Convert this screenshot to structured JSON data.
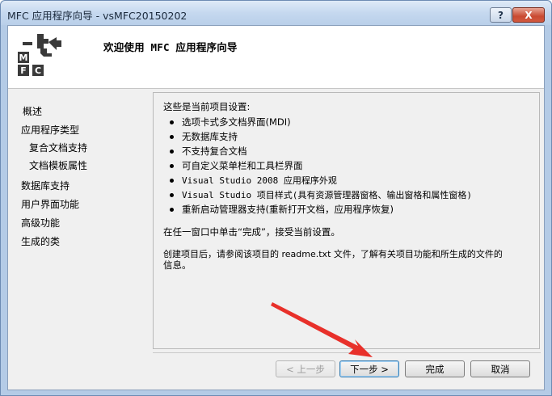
{
  "window": {
    "title": "MFC 应用程序向导 - vsMFC20150202",
    "help_label": "?",
    "close_label": "X"
  },
  "header": {
    "title": "欢迎使用 MFC 应用程序向导",
    "logo_letters": [
      "M",
      "F",
      "C"
    ]
  },
  "sidebar": {
    "items": [
      {
        "label": "概述"
      },
      {
        "label": "应用程序类型"
      },
      {
        "label": "复合文档支持"
      },
      {
        "label": "文档模板属性"
      },
      {
        "label": "数据库支持"
      },
      {
        "label": "用户界面功能"
      },
      {
        "label": "高级功能"
      },
      {
        "label": "生成的类"
      }
    ]
  },
  "content": {
    "intro": "这些是当前项目设置:",
    "bullets": [
      "选项卡式多文档界面(MDI)",
      "无数据库支持",
      "不支持复合文档",
      "可自定义菜单栏和工具栏界面",
      "Visual Studio 2008 应用程序外观",
      "Visual Studio 项目样式(具有资源管理器窗格、输出窗格和属性窗格)",
      "重新启动管理器支持(重新打开文档，应用程序恢复)"
    ],
    "finish_note": "在任一窗口中单击“完成”，接受当前设置。",
    "readme_line1": "创建项目后，请参阅该项目的 readme.txt 文件，了解有关项目功能和所生成的文件的",
    "readme_line2": "信息。"
  },
  "buttons": {
    "prev": "< 上一步",
    "next": "下一步 >",
    "finish": "完成",
    "cancel": "取消"
  },
  "colors": {
    "annotation_arrow": "#e8302a"
  }
}
